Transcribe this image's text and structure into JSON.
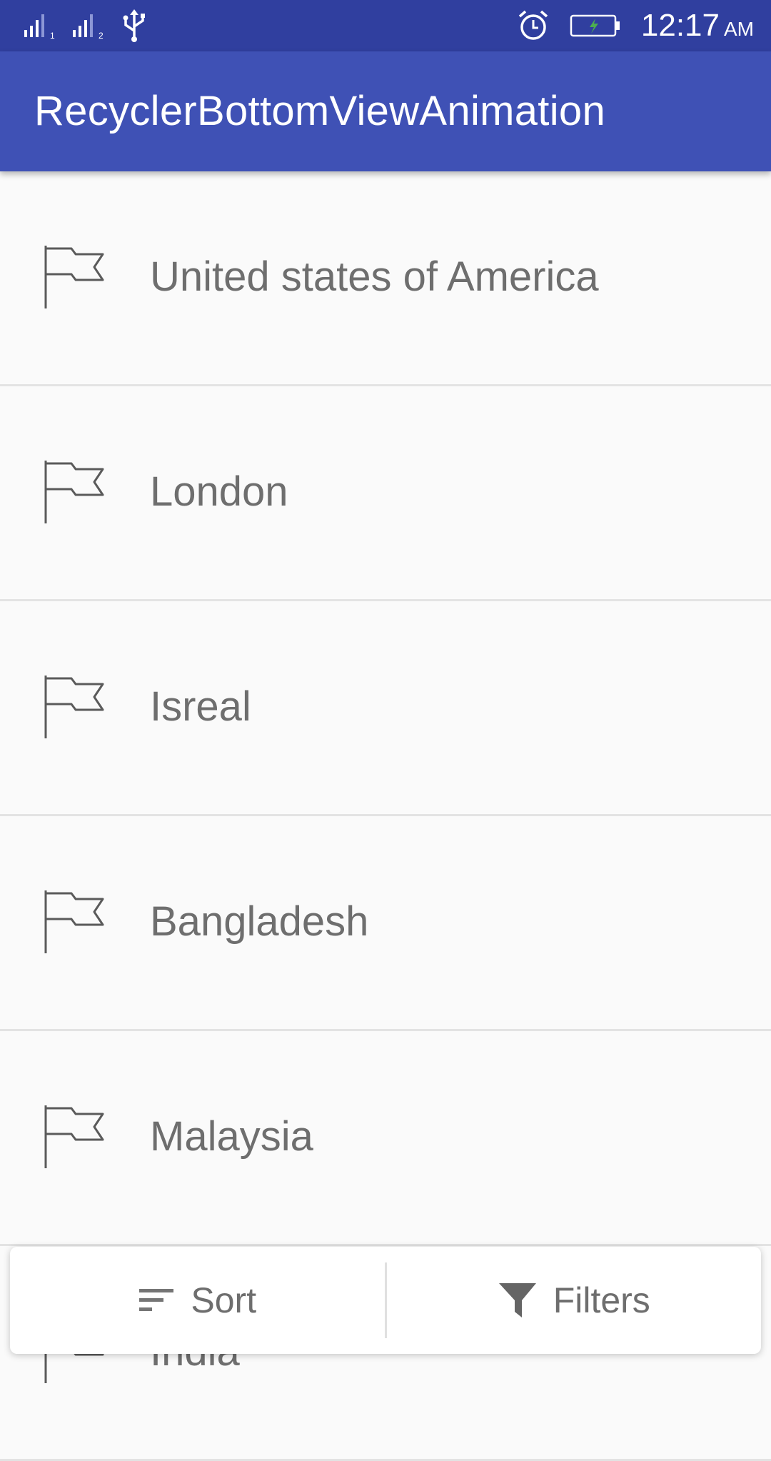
{
  "status_bar": {
    "time": "12:17",
    "ampm": "AM",
    "icons": [
      "signal-sim1-icon",
      "signal-sim2-icon",
      "usb-icon",
      "alarm-icon",
      "battery-charging-icon"
    ]
  },
  "app_bar": {
    "title": "RecyclerBottomViewAnimation"
  },
  "list": {
    "items": [
      {
        "label": "United states of America",
        "icon": "flag-icon"
      },
      {
        "label": "London",
        "icon": "flag-icon"
      },
      {
        "label": "Isreal",
        "icon": "flag-icon"
      },
      {
        "label": "Bangladesh",
        "icon": "flag-icon"
      },
      {
        "label": "Malaysia",
        "icon": "flag-icon"
      },
      {
        "label": "India",
        "icon": "flag-icon"
      }
    ]
  },
  "bottom_bar": {
    "sort_label": "Sort",
    "filters_label": "Filters"
  },
  "colors": {
    "status_bar": "#303F9F",
    "app_bar": "#3F51B5",
    "background": "#FAFAFA",
    "text": "#6E6E6E"
  }
}
